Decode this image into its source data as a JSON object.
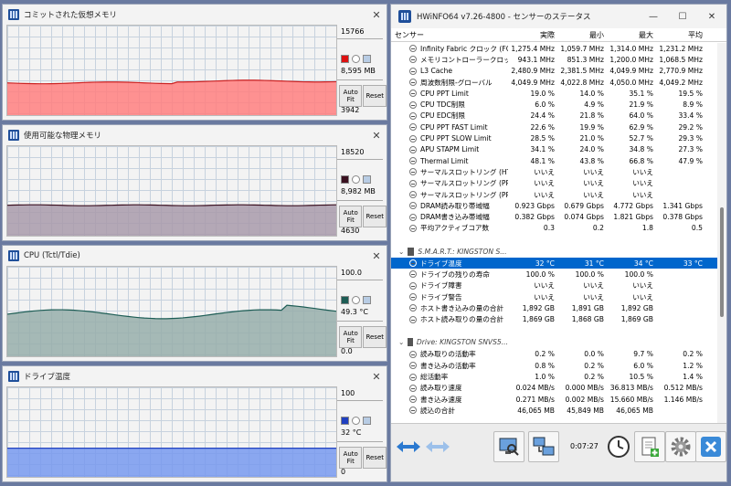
{
  "graphs": [
    {
      "title": "コミットされた仮想メモリ",
      "max": "15766",
      "current": "8,595 MB",
      "min": "3942",
      "color": "#ff7f7f",
      "line": "#cc2222",
      "swatch": "#dd1111",
      "level": 0.36,
      "autofit": "Auto Fit",
      "reset": "Reset"
    },
    {
      "title": "使用可能な物理メモリ",
      "max": "18520",
      "current": "8,982 MB",
      "min": "4630",
      "color": "#a89aaa",
      "line": "#3a1020",
      "swatch": "#3a1020",
      "level": 0.34,
      "autofit": "Auto Fit",
      "reset": "Reset"
    },
    {
      "title": "CPU (Tctl/Tdie)",
      "max": "100.0",
      "current": "49.3 °C",
      "min": "0.0",
      "color": "#96aeaa",
      "line": "#1d5d55",
      "swatch": "#1d5d55",
      "level": 0.47,
      "autofit": "Auto Fit",
      "reset": "Reset"
    },
    {
      "title": "ドライブ温度",
      "max": "100",
      "current": "32 °C",
      "min": "0",
      "color": "#7799ee",
      "line": "#2040c0",
      "swatch": "#2040c0",
      "level": 0.32,
      "autofit": "Auto Fit",
      "reset": "Reset"
    }
  ],
  "hwinfo": {
    "title": "HWiNFO64 v7.26-4800 - センサーのステータス",
    "columns": [
      "センサー",
      "実際",
      "最小",
      "最大",
      "平均"
    ],
    "rows": [
      {
        "type": "item",
        "name": "Infinity Fabric クロック (FC...",
        "v": [
          "1,275.4 MHz",
          "1,059.7 MHz",
          "1,314.0 MHz",
          "1,231.2 MHz"
        ]
      },
      {
        "type": "item",
        "name": "メモリコントローラークロック...",
        "v": [
          "943.1 MHz",
          "851.3 MHz",
          "1,200.0 MHz",
          "1,068.5 MHz"
        ]
      },
      {
        "type": "item",
        "name": "L3 Cache",
        "v": [
          "2,480.9 MHz",
          "2,381.5 MHz",
          "4,049.9 MHz",
          "2,770.9 MHz"
        ]
      },
      {
        "type": "item",
        "name": "周波数制限-グローバル",
        "v": [
          "4,049.9 MHz",
          "4,022.8 MHz",
          "4,050.0 MHz",
          "4,049.2 MHz"
        ]
      },
      {
        "type": "item",
        "name": "CPU PPT Limit",
        "v": [
          "19.0 %",
          "14.0 %",
          "35.1 %",
          "19.5 %"
        ]
      },
      {
        "type": "item",
        "name": "CPU TDC制限",
        "v": [
          "6.0 %",
          "4.9 %",
          "21.9 %",
          "8.9 %"
        ]
      },
      {
        "type": "item",
        "name": "CPU EDC制限",
        "v": [
          "24.4 %",
          "21.8 %",
          "64.0 %",
          "33.4 %"
        ]
      },
      {
        "type": "item",
        "name": "CPU PPT FAST Limit",
        "v": [
          "22.6 %",
          "19.9 %",
          "62.9 %",
          "29.2 %"
        ]
      },
      {
        "type": "item",
        "name": "CPU PPT SLOW Limit",
        "v": [
          "28.5 %",
          "21.0 %",
          "52.7 %",
          "29.3 %"
        ]
      },
      {
        "type": "item",
        "name": "APU STAPM Limit",
        "v": [
          "34.1 %",
          "24.0 %",
          "34.8 %",
          "27.3 %"
        ]
      },
      {
        "type": "item",
        "name": "Thermal Limit",
        "v": [
          "48.1 %",
          "43.8 %",
          "66.8 %",
          "47.9 %"
        ]
      },
      {
        "type": "item",
        "name": "サーマルスロットリング (HTC)",
        "v": [
          "いいえ",
          "いいえ",
          "いいえ",
          ""
        ]
      },
      {
        "type": "item",
        "name": "サーマルスロットリング (PR...",
        "v": [
          "いいえ",
          "いいえ",
          "いいえ",
          ""
        ]
      },
      {
        "type": "item",
        "name": "サーマルスロットリング (PR...",
        "v": [
          "いいえ",
          "いいえ",
          "いいえ",
          ""
        ]
      },
      {
        "type": "item",
        "name": "DRAM読み取り帯域幅",
        "v": [
          "0.923 Gbps",
          "0.679 Gbps",
          "4.772 Gbps",
          "1.341 Gbps"
        ]
      },
      {
        "type": "item",
        "name": "DRAM書き込み帯域幅",
        "v": [
          "0.382 Gbps",
          "0.074 Gbps",
          "1.821 Gbps",
          "0.378 Gbps"
        ]
      },
      {
        "type": "item",
        "name": "平均アクティブコア数",
        "v": [
          "0.3",
          "0.2",
          "1.8",
          "0.5"
        ]
      },
      {
        "type": "spacer"
      },
      {
        "type": "group",
        "name": "S.M.A.R.T.: KINGSTON S..."
      },
      {
        "type": "item",
        "sel": true,
        "name": "ドライブ温度",
        "v": [
          "32 °C",
          "31 °C",
          "34 °C",
          "33 °C"
        ]
      },
      {
        "type": "item",
        "name": "ドライブの残りの寿命",
        "v": [
          "100.0 %",
          "100.0 %",
          "100.0 %",
          ""
        ]
      },
      {
        "type": "item",
        "name": "ドライブ障害",
        "v": [
          "いいえ",
          "いいえ",
          "いいえ",
          ""
        ]
      },
      {
        "type": "item",
        "name": "ドライブ警告",
        "v": [
          "いいえ",
          "いいえ",
          "いいえ",
          ""
        ]
      },
      {
        "type": "item",
        "name": "ホスト書き込みの量の合計",
        "v": [
          "1,892 GB",
          "1,891 GB",
          "1,892 GB",
          ""
        ]
      },
      {
        "type": "item",
        "name": "ホスト読み取りの量の合計",
        "v": [
          "1,869 GB",
          "1,868 GB",
          "1,869 GB",
          ""
        ]
      },
      {
        "type": "spacer"
      },
      {
        "type": "group",
        "name": "Drive: KINGSTON SNVS5..."
      },
      {
        "type": "item",
        "name": "読み取りの活動率",
        "v": [
          "0.2 %",
          "0.0 %",
          "9.7 %",
          "0.2 %"
        ]
      },
      {
        "type": "item",
        "name": "書き込みの活動率",
        "v": [
          "0.8 %",
          "0.2 %",
          "6.0 %",
          "1.2 %"
        ]
      },
      {
        "type": "item",
        "name": "総活動率",
        "v": [
          "1.0 %",
          "0.2 %",
          "10.5 %",
          "1.4 %"
        ]
      },
      {
        "type": "item",
        "name": "読み取り速度",
        "v": [
          "0.024 MB/s",
          "0.000 MB/s",
          "36.813 MB/s",
          "0.512 MB/s"
        ]
      },
      {
        "type": "item",
        "name": "書き込み速度",
        "v": [
          "0.271 MB/s",
          "0.002 MB/s",
          "15.660 MB/s",
          "1.146 MB/s"
        ]
      },
      {
        "type": "item",
        "name": "読込の合計",
        "v": [
          "46,065 MB",
          "45,849 MB",
          "46,065 MB",
          ""
        ]
      }
    ],
    "timer": "0:07:27"
  }
}
